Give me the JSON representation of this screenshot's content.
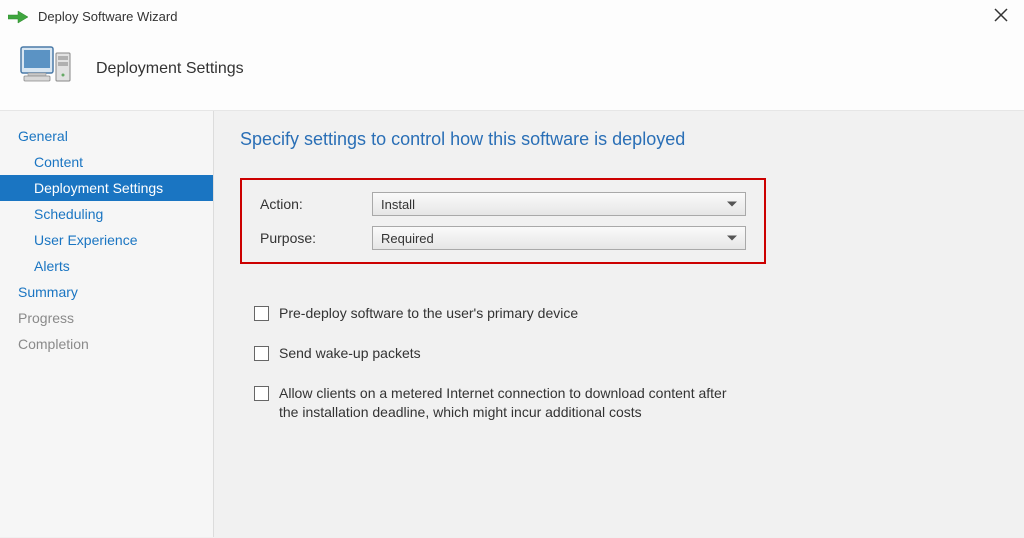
{
  "window": {
    "title": "Deploy Software Wizard"
  },
  "header": {
    "heading": "Deployment Settings"
  },
  "sidebar": {
    "items": [
      {
        "label": "General",
        "sub": false,
        "selected": false,
        "muted": false
      },
      {
        "label": "Content",
        "sub": true,
        "selected": false,
        "muted": false
      },
      {
        "label": "Deployment Settings",
        "sub": true,
        "selected": true,
        "muted": false
      },
      {
        "label": "Scheduling",
        "sub": true,
        "selected": false,
        "muted": false
      },
      {
        "label": "User Experience",
        "sub": true,
        "selected": false,
        "muted": false
      },
      {
        "label": "Alerts",
        "sub": true,
        "selected": false,
        "muted": false
      },
      {
        "label": "Summary",
        "sub": false,
        "selected": false,
        "muted": false
      },
      {
        "label": "Progress",
        "sub": false,
        "selected": false,
        "muted": true
      },
      {
        "label": "Completion",
        "sub": false,
        "selected": false,
        "muted": true
      }
    ]
  },
  "content": {
    "section_title": "Specify settings to control how this software is deployed",
    "action": {
      "label": "Action:",
      "value": "Install"
    },
    "purpose": {
      "label": "Purpose:",
      "value": "Required"
    },
    "checkboxes": [
      {
        "label": "Pre-deploy software to the user's primary device",
        "checked": false
      },
      {
        "label": "Send wake-up packets",
        "checked": false
      },
      {
        "label": "Allow clients on a metered Internet connection to download content after the installation deadline, which might incur additional costs",
        "checked": false
      }
    ]
  }
}
